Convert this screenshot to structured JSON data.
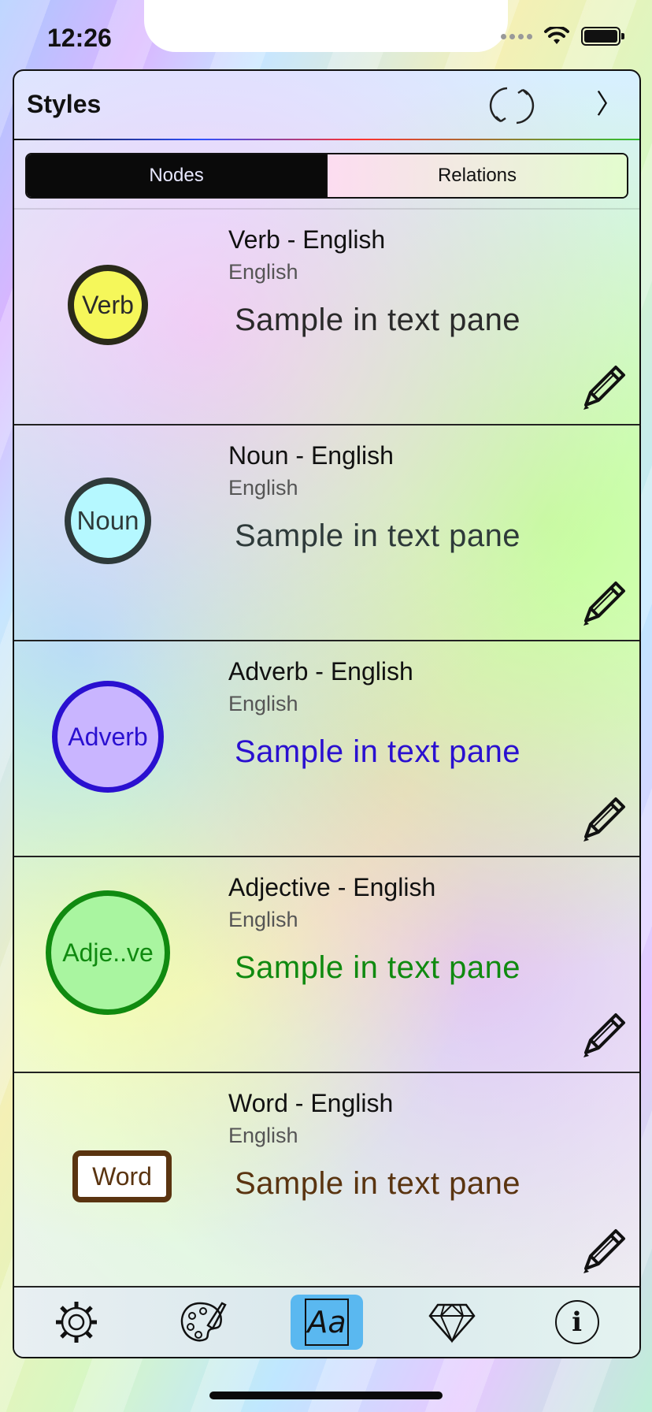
{
  "status_bar": {
    "time": "12:26"
  },
  "header": {
    "title": "Styles"
  },
  "segments": [
    {
      "label": "Nodes",
      "active": true
    },
    {
      "label": "Relations",
      "active": false
    }
  ],
  "styles": [
    {
      "name": "Verb - English",
      "language": "English",
      "sample": "Sample in text pane",
      "node_label": "Verb",
      "fill": "#f5f75a",
      "border": "#2a2a1a",
      "text_color": "#2a2a2a",
      "shape": "circle"
    },
    {
      "name": "Noun - English",
      "language": "English",
      "sample": "Sample in text pane",
      "node_label": "Noun",
      "fill": "#b5f8ff",
      "border": "#2e3a3a",
      "text_color": "#2e3a3a",
      "shape": "circle"
    },
    {
      "name": "Adverb - English",
      "language": "English",
      "sample": "Sample in text pane",
      "node_label": "Adverb",
      "fill": "#c9b5ff",
      "border": "#2a10d0",
      "text_color": "#2a10d0",
      "shape": "circle"
    },
    {
      "name": "Adjective - English",
      "language": "English",
      "sample": "Sample in text pane",
      "node_label": "Adje..ve",
      "fill": "#a9f5a0",
      "border": "#108a10",
      "text_color": "#108a10",
      "shape": "circle"
    },
    {
      "name": "Word - English",
      "language": "English",
      "sample": "Sample in text pane",
      "node_label": "Word",
      "fill": "#ffffff",
      "border": "#5a3410",
      "text_color": "#5a3410",
      "shape": "rounded-rect"
    }
  ],
  "tabbar": {
    "tabs": [
      {
        "icon": "gear-icon"
      },
      {
        "icon": "palette-icon"
      },
      {
        "icon": "font-aa-icon",
        "selected": true,
        "label": "Aa"
      },
      {
        "icon": "diamond-icon"
      },
      {
        "icon": "info-icon",
        "label": "i"
      }
    ]
  }
}
